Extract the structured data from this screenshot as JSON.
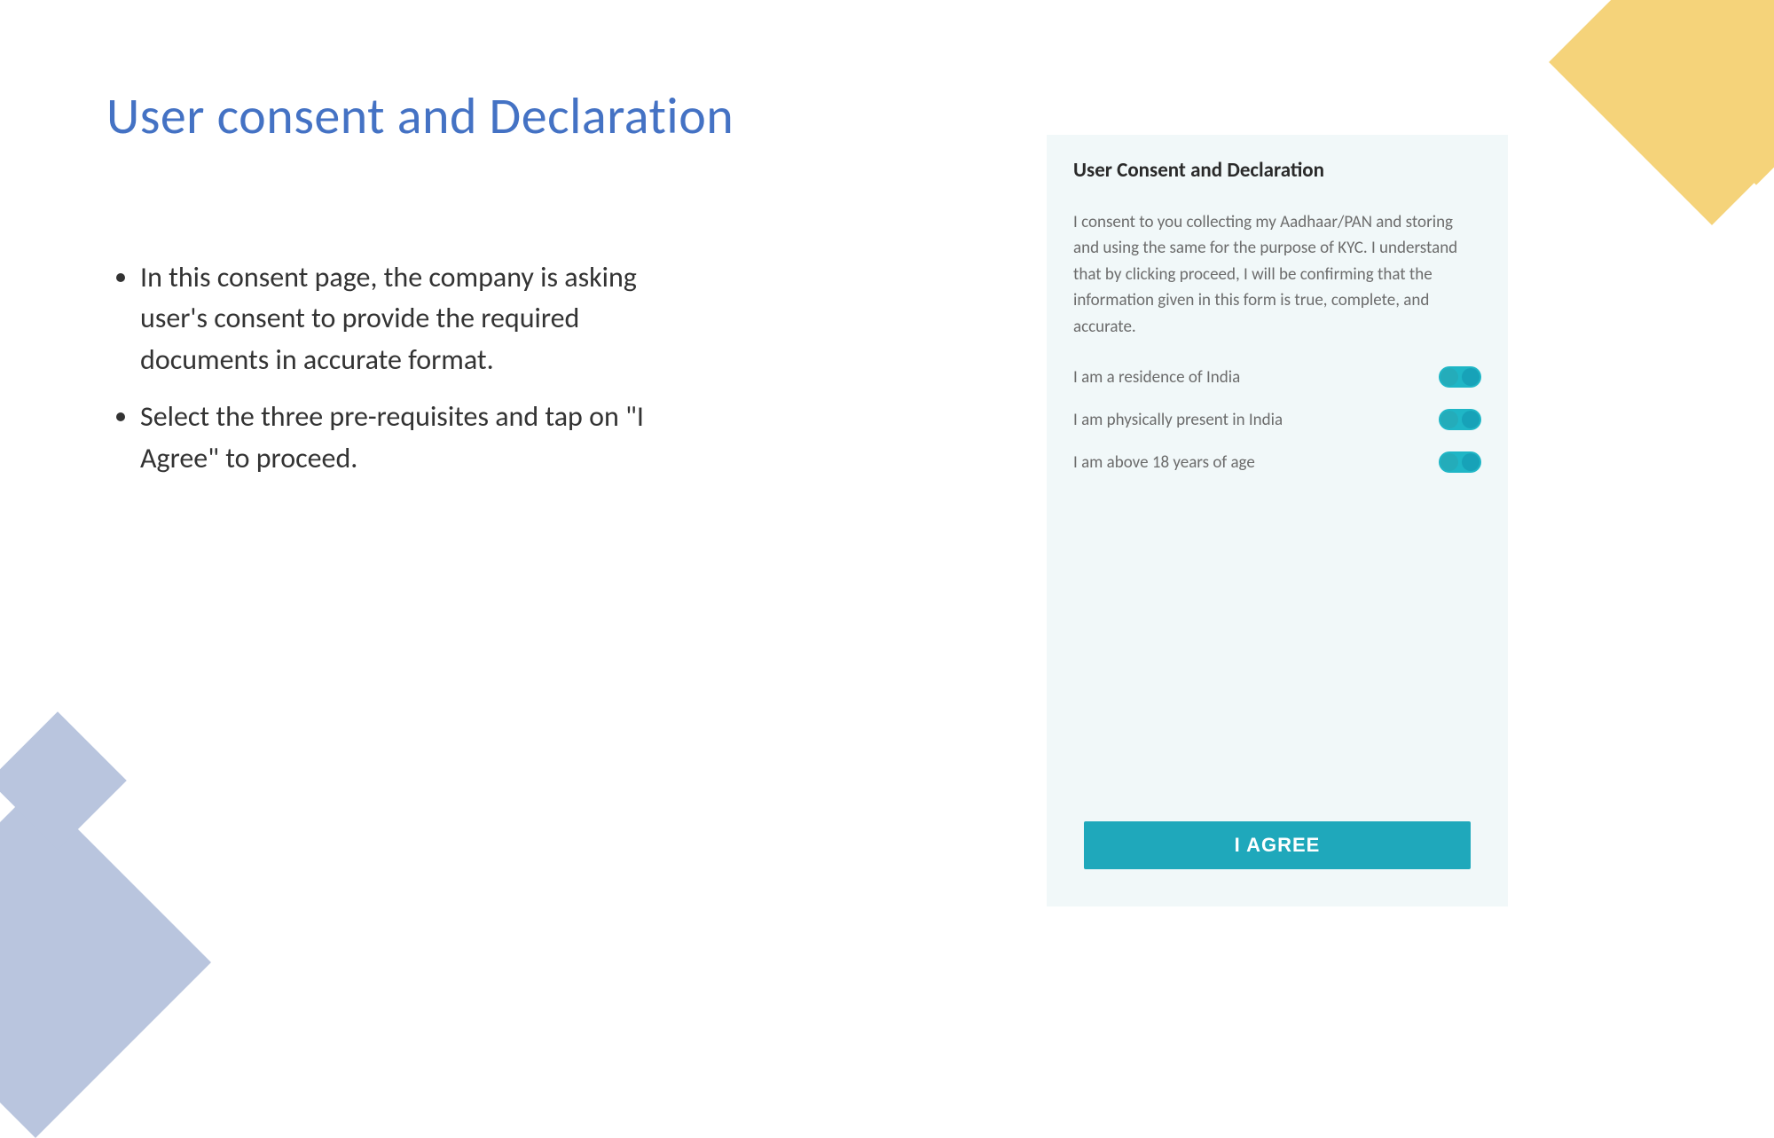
{
  "slide": {
    "title": "User consent and Declaration",
    "bullets": [
      "In this consent page, the company is asking user's consent to provide the required documents in accurate format.",
      "Select the three pre-requisites and tap on \"I Agree\" to proceed."
    ]
  },
  "panel": {
    "heading": "User Consent and Declaration",
    "body": "I consent to you collecting my Aadhaar/PAN and storing and using the same for the purpose of KYC. I understand that by clicking proceed, I will be confirming that the information given in this form is true, complete, and accurate.",
    "toggles": [
      {
        "label": "I am a residence of India",
        "on": true
      },
      {
        "label": "I am physically present in India",
        "on": true
      },
      {
        "label": "I am above 18 years of age",
        "on": true
      }
    ],
    "button_label": "I AGREE"
  },
  "colors": {
    "title": "#4472c4",
    "accent": "#1fa8bb",
    "panel_bg": "#f1f8f9",
    "deco_yellow": "#f5d37a",
    "deco_blue": "#b9c5de"
  }
}
